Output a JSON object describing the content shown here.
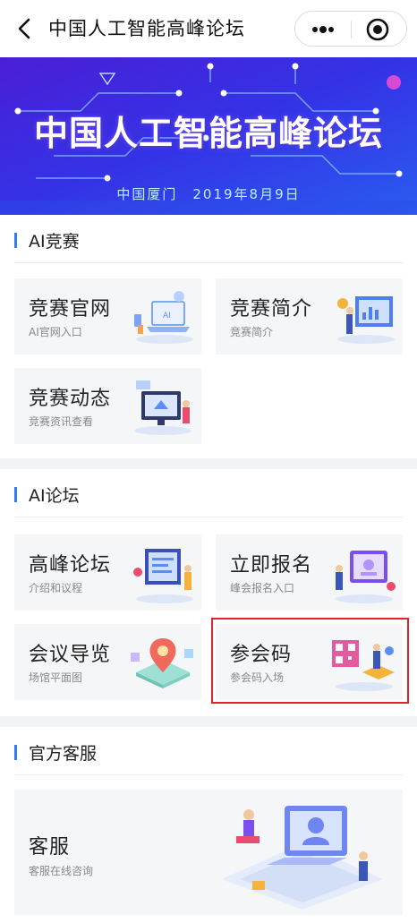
{
  "nav": {
    "title": "中国人工智能高峰论坛"
  },
  "banner": {
    "title": "中国人工智能高峰论坛",
    "subtitle": "中国厦门　2019年8月9日"
  },
  "sections": [
    {
      "title": "AI竞赛",
      "cards": [
        {
          "title": "竞赛官网",
          "sub": "AI官网入口",
          "icon": "laptop-ai-illustration"
        },
        {
          "title": "竞赛简介",
          "sub": "竞赛简介",
          "icon": "presentation-illustration"
        },
        {
          "title": "竞赛动态",
          "sub": "竞赛资讯查看",
          "icon": "monitor-news-illustration"
        }
      ]
    },
    {
      "title": "AI论坛",
      "cards": [
        {
          "title": "高峰论坛",
          "sub": "介绍和议程",
          "icon": "forum-screen-illustration"
        },
        {
          "title": "立即报名",
          "sub": "峰会报名入口",
          "icon": "signup-illustration"
        },
        {
          "title": "会议导览",
          "sub": "场馆平面图",
          "icon": "map-pin-illustration"
        },
        {
          "title": "参会码",
          "sub": "参会码入场",
          "icon": "qr-code-illustration"
        }
      ]
    },
    {
      "title": "官方客服",
      "cards": [
        {
          "title": "客服",
          "sub": "客服在线咨询",
          "icon": "customer-service-illustration"
        }
      ]
    }
  ],
  "colors": {
    "accent": "#2f7cf6",
    "highlight": "#e0242c",
    "card_bg": "#f5f6f8",
    "banner": "#3a3ae8"
  }
}
